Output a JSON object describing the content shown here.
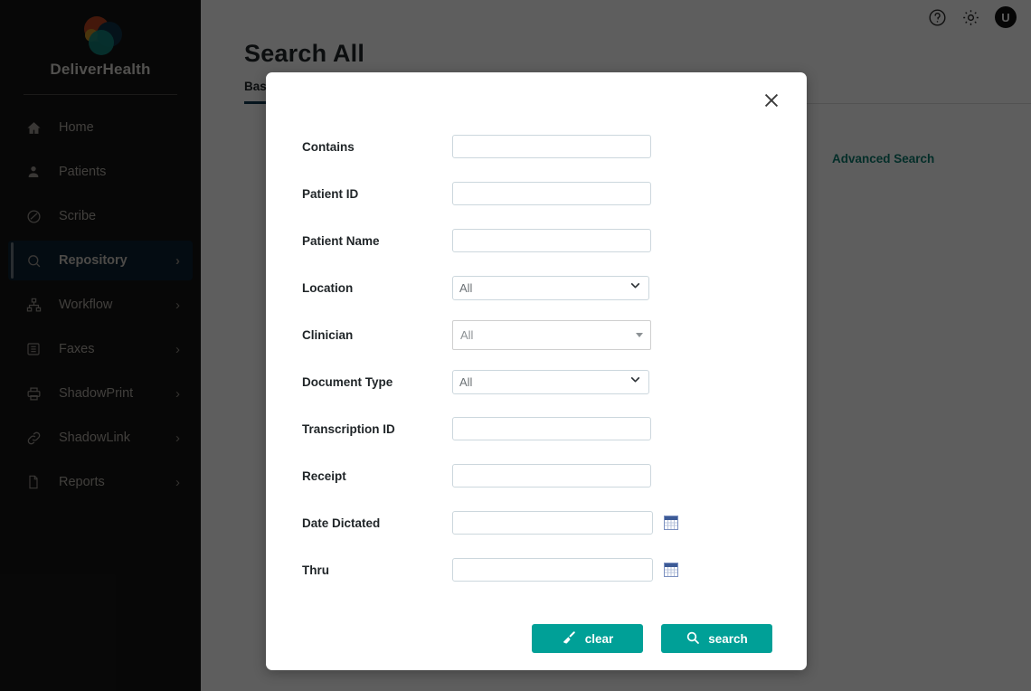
{
  "sidebar": {
    "brand": "DeliverHealth",
    "logo_colors": {
      "orange": "#b8431f",
      "navy": "#0e3247",
      "teal": "#12877e",
      "gold": "#c99024"
    },
    "items": [
      {
        "label": "Home",
        "icon": "home-icon",
        "chevron": "",
        "active": false
      },
      {
        "label": "Patients",
        "icon": "user-icon",
        "chevron": "",
        "active": false
      },
      {
        "label": "Scribe",
        "icon": "scribe-icon",
        "chevron": "",
        "active": false
      },
      {
        "label": "Repository",
        "icon": "search-icon",
        "chevron": "›",
        "active": true
      },
      {
        "label": "Workflow",
        "icon": "sitemap-icon",
        "chevron": "›",
        "active": false
      },
      {
        "label": "Faxes",
        "icon": "fax-icon",
        "chevron": "›",
        "active": false
      },
      {
        "label": "ShadowPrint",
        "icon": "printer-icon",
        "chevron": "›",
        "active": false
      },
      {
        "label": "ShadowLink",
        "icon": "link-icon",
        "chevron": "›",
        "active": false
      },
      {
        "label": "Reports",
        "icon": "document-icon",
        "chevron": "›",
        "active": false
      }
    ]
  },
  "topbar": {
    "help_icon": "help-circle-icon",
    "settings_icon": "gear-icon",
    "avatar_initial": "U"
  },
  "page": {
    "title": "Search All",
    "tabs": [
      {
        "label": "Basic Search",
        "active": true
      }
    ],
    "advanced_search_link": "Advanced Search",
    "accent_color": "#0d7c6f"
  },
  "modal": {
    "close_icon": "close-icon",
    "fields": [
      {
        "label": "Contains",
        "type": "text",
        "value": "",
        "placeholder": ""
      },
      {
        "label": "Patient ID",
        "type": "text",
        "value": "",
        "placeholder": ""
      },
      {
        "label": "Patient Name",
        "type": "text",
        "value": "",
        "placeholder": ""
      },
      {
        "label": "Location",
        "type": "select",
        "value": "All",
        "options": [
          "All"
        ]
      },
      {
        "label": "Clinician",
        "type": "combo",
        "value": "All",
        "options": [
          "All"
        ]
      },
      {
        "label": "Document Type",
        "type": "select",
        "value": "All",
        "options": [
          "All"
        ]
      },
      {
        "label": "Transcription ID",
        "type": "text",
        "value": "",
        "placeholder": ""
      },
      {
        "label": "Receipt",
        "type": "text",
        "value": "",
        "placeholder": ""
      },
      {
        "label": "Date Dictated",
        "type": "date",
        "value": "",
        "placeholder": "",
        "icon": "calendar-icon"
      },
      {
        "label": "Thru",
        "type": "date",
        "value": "",
        "placeholder": "",
        "icon": "calendar-icon"
      }
    ],
    "buttons": {
      "clear": {
        "label": "clear",
        "icon": "broom-icon",
        "color": "#00a097"
      },
      "search": {
        "label": "search",
        "icon": "search-icon",
        "color": "#00a097"
      }
    }
  }
}
